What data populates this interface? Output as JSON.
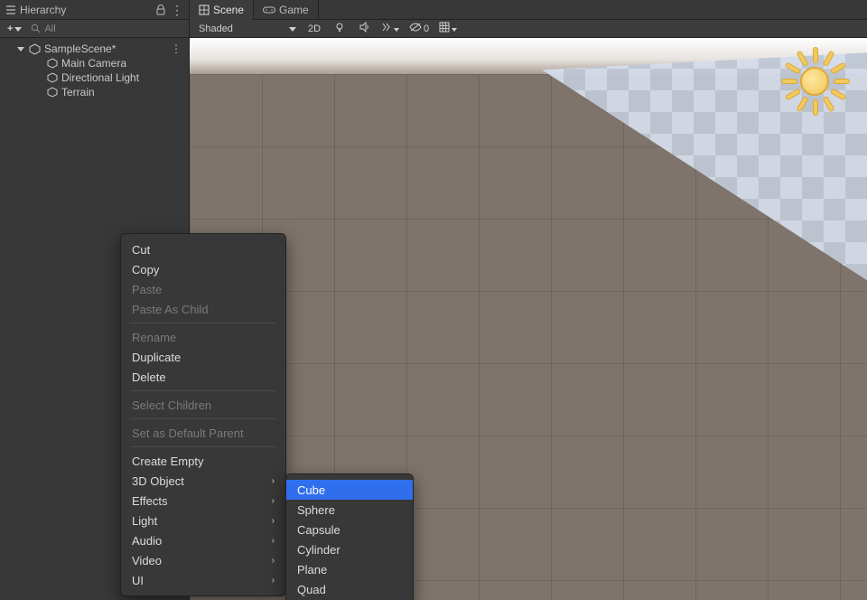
{
  "hierarchy": {
    "title": "Hierarchy",
    "search_placeholder": "All",
    "scene_name": "SampleScene*",
    "children": [
      {
        "label": "Main Camera"
      },
      {
        "label": "Directional Light"
      },
      {
        "label": "Terrain"
      }
    ]
  },
  "scene": {
    "tabs": [
      {
        "label": "Scene",
        "active": true
      },
      {
        "label": "Game",
        "active": false
      }
    ],
    "shading_mode": "Shaded",
    "btn_2d": "2D",
    "gizmos_visible_count": "0"
  },
  "context_menu": {
    "items": [
      {
        "label": "Cut",
        "enabled": true
      },
      {
        "label": "Copy",
        "enabled": true
      },
      {
        "label": "Paste",
        "enabled": false
      },
      {
        "label": "Paste As Child",
        "enabled": false
      },
      {
        "sep": true
      },
      {
        "label": "Rename",
        "enabled": false
      },
      {
        "label": "Duplicate",
        "enabled": true
      },
      {
        "label": "Delete",
        "enabled": true
      },
      {
        "sep": true
      },
      {
        "label": "Select Children",
        "enabled": false
      },
      {
        "sep": true
      },
      {
        "label": "Set as Default Parent",
        "enabled": false
      },
      {
        "sep": true
      },
      {
        "label": "Create Empty",
        "enabled": true
      },
      {
        "label": "3D Object",
        "enabled": true,
        "submenu": true,
        "hover": true
      },
      {
        "label": "Effects",
        "enabled": true,
        "submenu": true
      },
      {
        "label": "Light",
        "enabled": true,
        "submenu": true
      },
      {
        "label": "Audio",
        "enabled": true,
        "submenu": true
      },
      {
        "label": "Video",
        "enabled": true,
        "submenu": true
      },
      {
        "label": "UI",
        "enabled": true,
        "submenu": true
      }
    ]
  },
  "submenu_3d_object": {
    "items": [
      {
        "label": "Cube",
        "selected": true
      },
      {
        "label": "Sphere"
      },
      {
        "label": "Capsule"
      },
      {
        "label": "Cylinder"
      },
      {
        "label": "Plane"
      },
      {
        "label": "Quad"
      }
    ]
  },
  "colors": {
    "accent": "#2f6fed",
    "panel_bg": "#383838",
    "toolbar_bg": "#3c3c3c",
    "ground": "#7e746b"
  }
}
